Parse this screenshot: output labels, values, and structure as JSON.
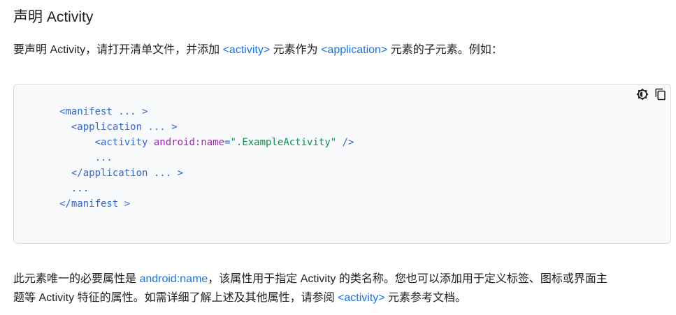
{
  "section": {
    "heading": "声明 Activity"
  },
  "intro": {
    "before": "要声明 Activity，请打开清单文件，并添加 ",
    "link1": "<activity>",
    "middle": " 元素作为 ",
    "link2": "<application>",
    "after": " 元素的子元素。例如："
  },
  "code": {
    "tools": {
      "theme_icon": "theme-toggle-icon",
      "copy_icon": "copy-icon"
    },
    "lines": {
      "l1_indent": "",
      "l1_text": "<manifest ... >",
      "l2_indent": "  ",
      "l2_text": "<application ... >",
      "l3_indent": "      ",
      "l3_tag_open": "<activity ",
      "l3_attr": "android:name",
      "l3_eq": "=",
      "l3_value": "\".ExampleActivity\"",
      "l3_tag_close": " />",
      "l4_indent": "      ",
      "l4_text": "...",
      "l5_indent": "  ",
      "l5_text": "</application ... >",
      "l6_indent": "  ",
      "l6_text": "...",
      "l7_indent": "",
      "l7_text": "</manifest >"
    }
  },
  "outro": {
    "line1_before": "此元素唯一的必要属性是 ",
    "line1_link": "android:name",
    "line1_after": "，该属性用于指定 Activity 的类名称。您也可以添加用于定义标签、图标或界面主",
    "line2_before": "题等 Activity 特征的属性。如需详细了解上述及其他属性，请参阅 ",
    "line2_link": "<activity>",
    "line2_after": " 元素参考文档。"
  },
  "colors": {
    "link": "#1a73e8",
    "code_tag": "#3367d6",
    "code_attr": "#9c27b0",
    "code_string": "#0d904f",
    "code_background": "#f8f9fa"
  }
}
